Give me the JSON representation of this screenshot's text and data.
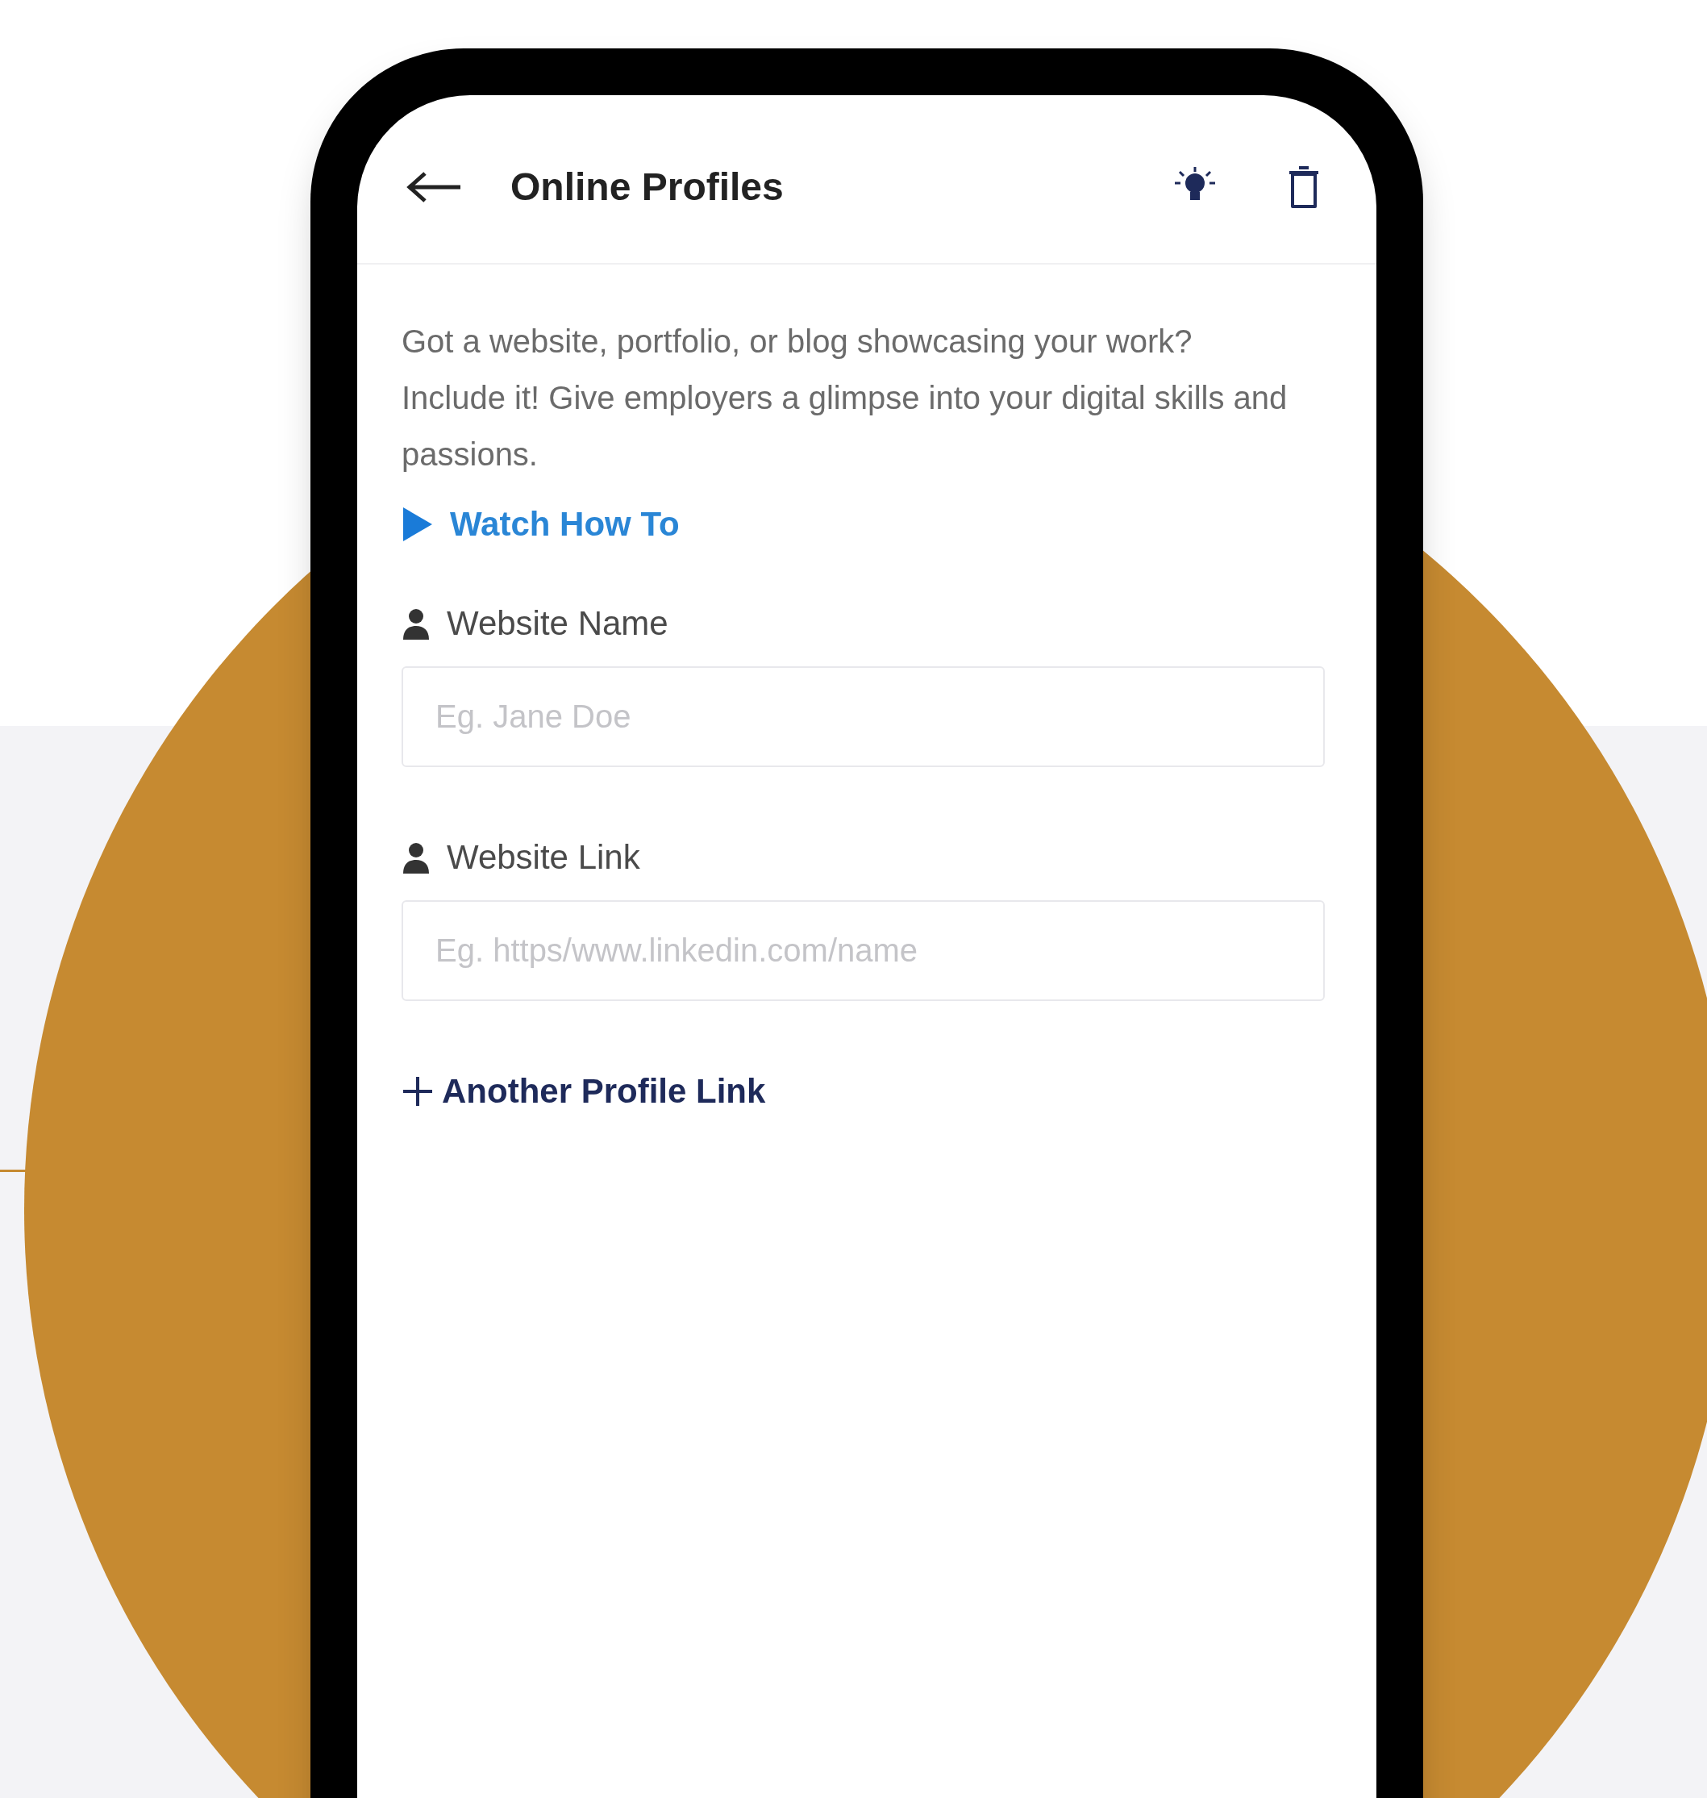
{
  "header": {
    "title": "Online Profiles"
  },
  "description": "Got a website, portfolio, or blog showcasing your work? Include it! Give employers a glimpse into your digital skills and passions.",
  "video_link": {
    "label": "Watch How To"
  },
  "fields": [
    {
      "label": "Website Name",
      "placeholder": "Eg. Jane Doe"
    },
    {
      "label": "Website Link",
      "placeholder": "Eg. https/www.linkedin.com/name"
    }
  ],
  "add_button": {
    "label": "Another Profile Link"
  }
}
